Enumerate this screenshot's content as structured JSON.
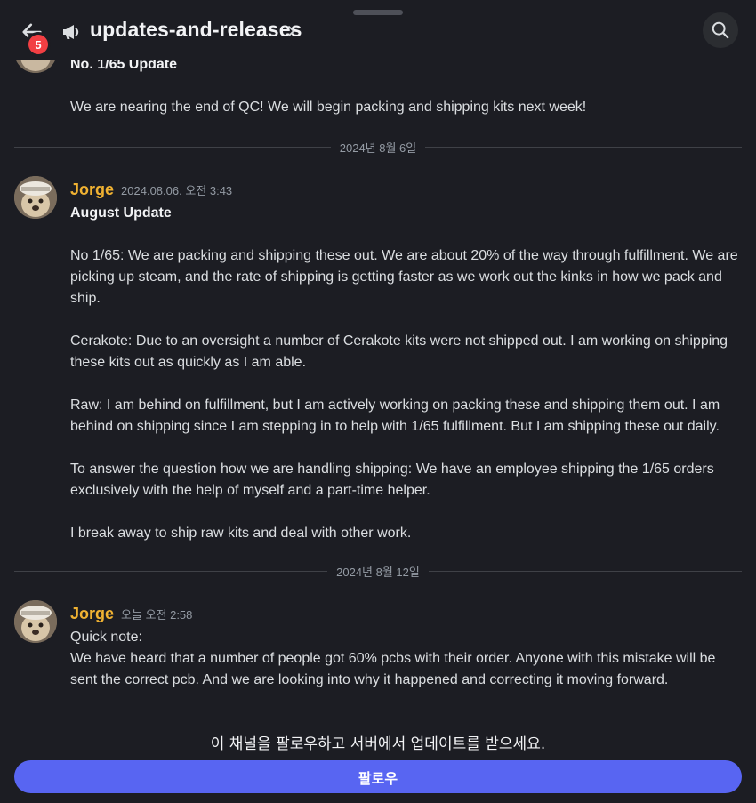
{
  "header": {
    "channel_name": "updates-and-releases",
    "back_badge_count": "5"
  },
  "messages": {
    "top_partial": {
      "title": "No. 1/65 Update",
      "body": "We are nearing the end of QC! We will begin packing and shipping kits next week!"
    },
    "divider_1": "2024년 8월 6일",
    "msg_1": {
      "author": "Jorge",
      "timestamp": "2024.08.06. 오전 3:43",
      "title": "August Update",
      "paragraphs": [
        "No 1/65: We are packing and shipping these out. We are about 20% of the way through fulfillment. We are picking up steam, and the rate of shipping is getting faster as we work out the kinks in how we pack and ship.",
        "Cerakote: Due to an oversight a number of Cerakote kits were not shipped out. I am working on shipping these kits out as quickly as I am able.",
        "Raw: I am behind on fulfillment, but I am actively working on packing these and shipping them out. I am behind on shipping since I am stepping in to help with 1/65 fulfillment. But I am shipping these out daily.",
        "To answer the question how we are handling shipping: We have an employee shipping the 1/65 orders exclusively with the help of myself and a part-time helper.",
        "I break away to ship raw kits and deal with other work."
      ]
    },
    "divider_2": "2024년 8월 12일",
    "msg_2": {
      "author": "Jorge",
      "timestamp": "오늘 오전 2:58",
      "line_1": "Quick note:",
      "line_2": "We have heard that a number of people got 60% pcbs with their order. Anyone with this mistake will be sent the correct pcb. And we are looking into why it happened and correcting it moving forward."
    }
  },
  "footer": {
    "prompt": "이 채널을 팔로우하고 서버에서 업데이트를 받으세요.",
    "follow_label": "팔로우"
  },
  "colors": {
    "background": "#1c1d23",
    "author": "#f0b232",
    "accent": "#5865f2",
    "badge": "#f23f43"
  },
  "icons": {
    "back": "arrow-left-icon",
    "channel": "megaphone-icon",
    "chevron": "chevron-right-icon",
    "search": "search-icon"
  }
}
